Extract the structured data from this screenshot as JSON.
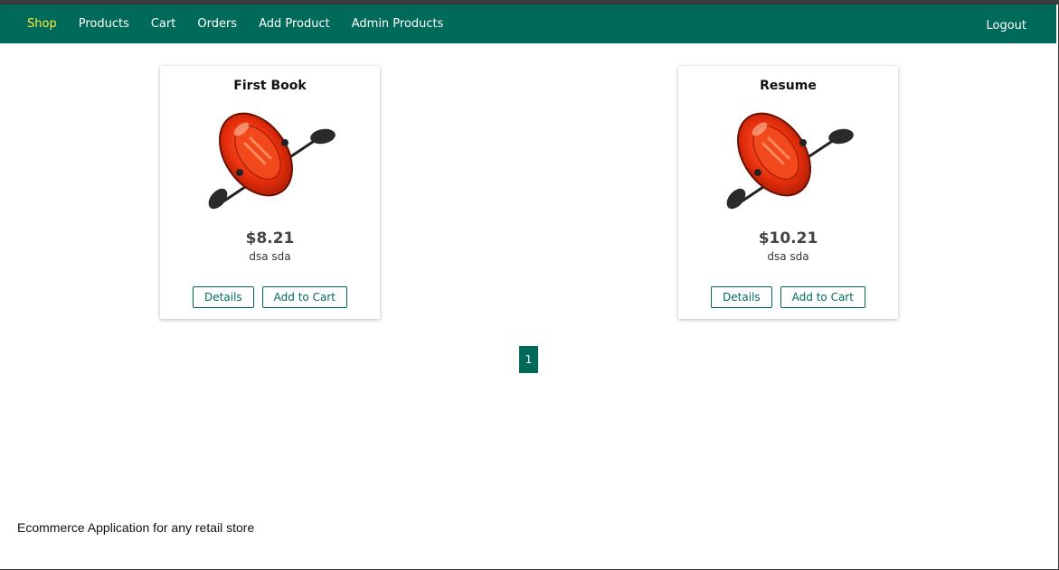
{
  "nav": {
    "items": [
      {
        "label": "Shop",
        "active": true
      },
      {
        "label": "Products",
        "active": false
      },
      {
        "label": "Cart",
        "active": false
      },
      {
        "label": "Orders",
        "active": false
      },
      {
        "label": "Add Product",
        "active": false
      },
      {
        "label": "Admin Products",
        "active": false
      }
    ],
    "logout": "Logout"
  },
  "products": [
    {
      "title": "First Book",
      "price": "$8.21",
      "description": "dsa sda",
      "details_label": "Details",
      "cart_label": "Add to Cart",
      "image_icon": "inflatable-boat-icon"
    },
    {
      "title": "Resume",
      "price": "$10.21",
      "description": "dsa sda",
      "details_label": "Details",
      "cart_label": "Add to Cart",
      "image_icon": "inflatable-boat-icon"
    }
  ],
  "pagination": {
    "current": "1"
  },
  "footer": {
    "text": "Ecommerce Application for any retail store"
  },
  "colors": {
    "nav_background": "#006a5a",
    "nav_active": "#ffe73c",
    "accent": "#006a5a"
  }
}
